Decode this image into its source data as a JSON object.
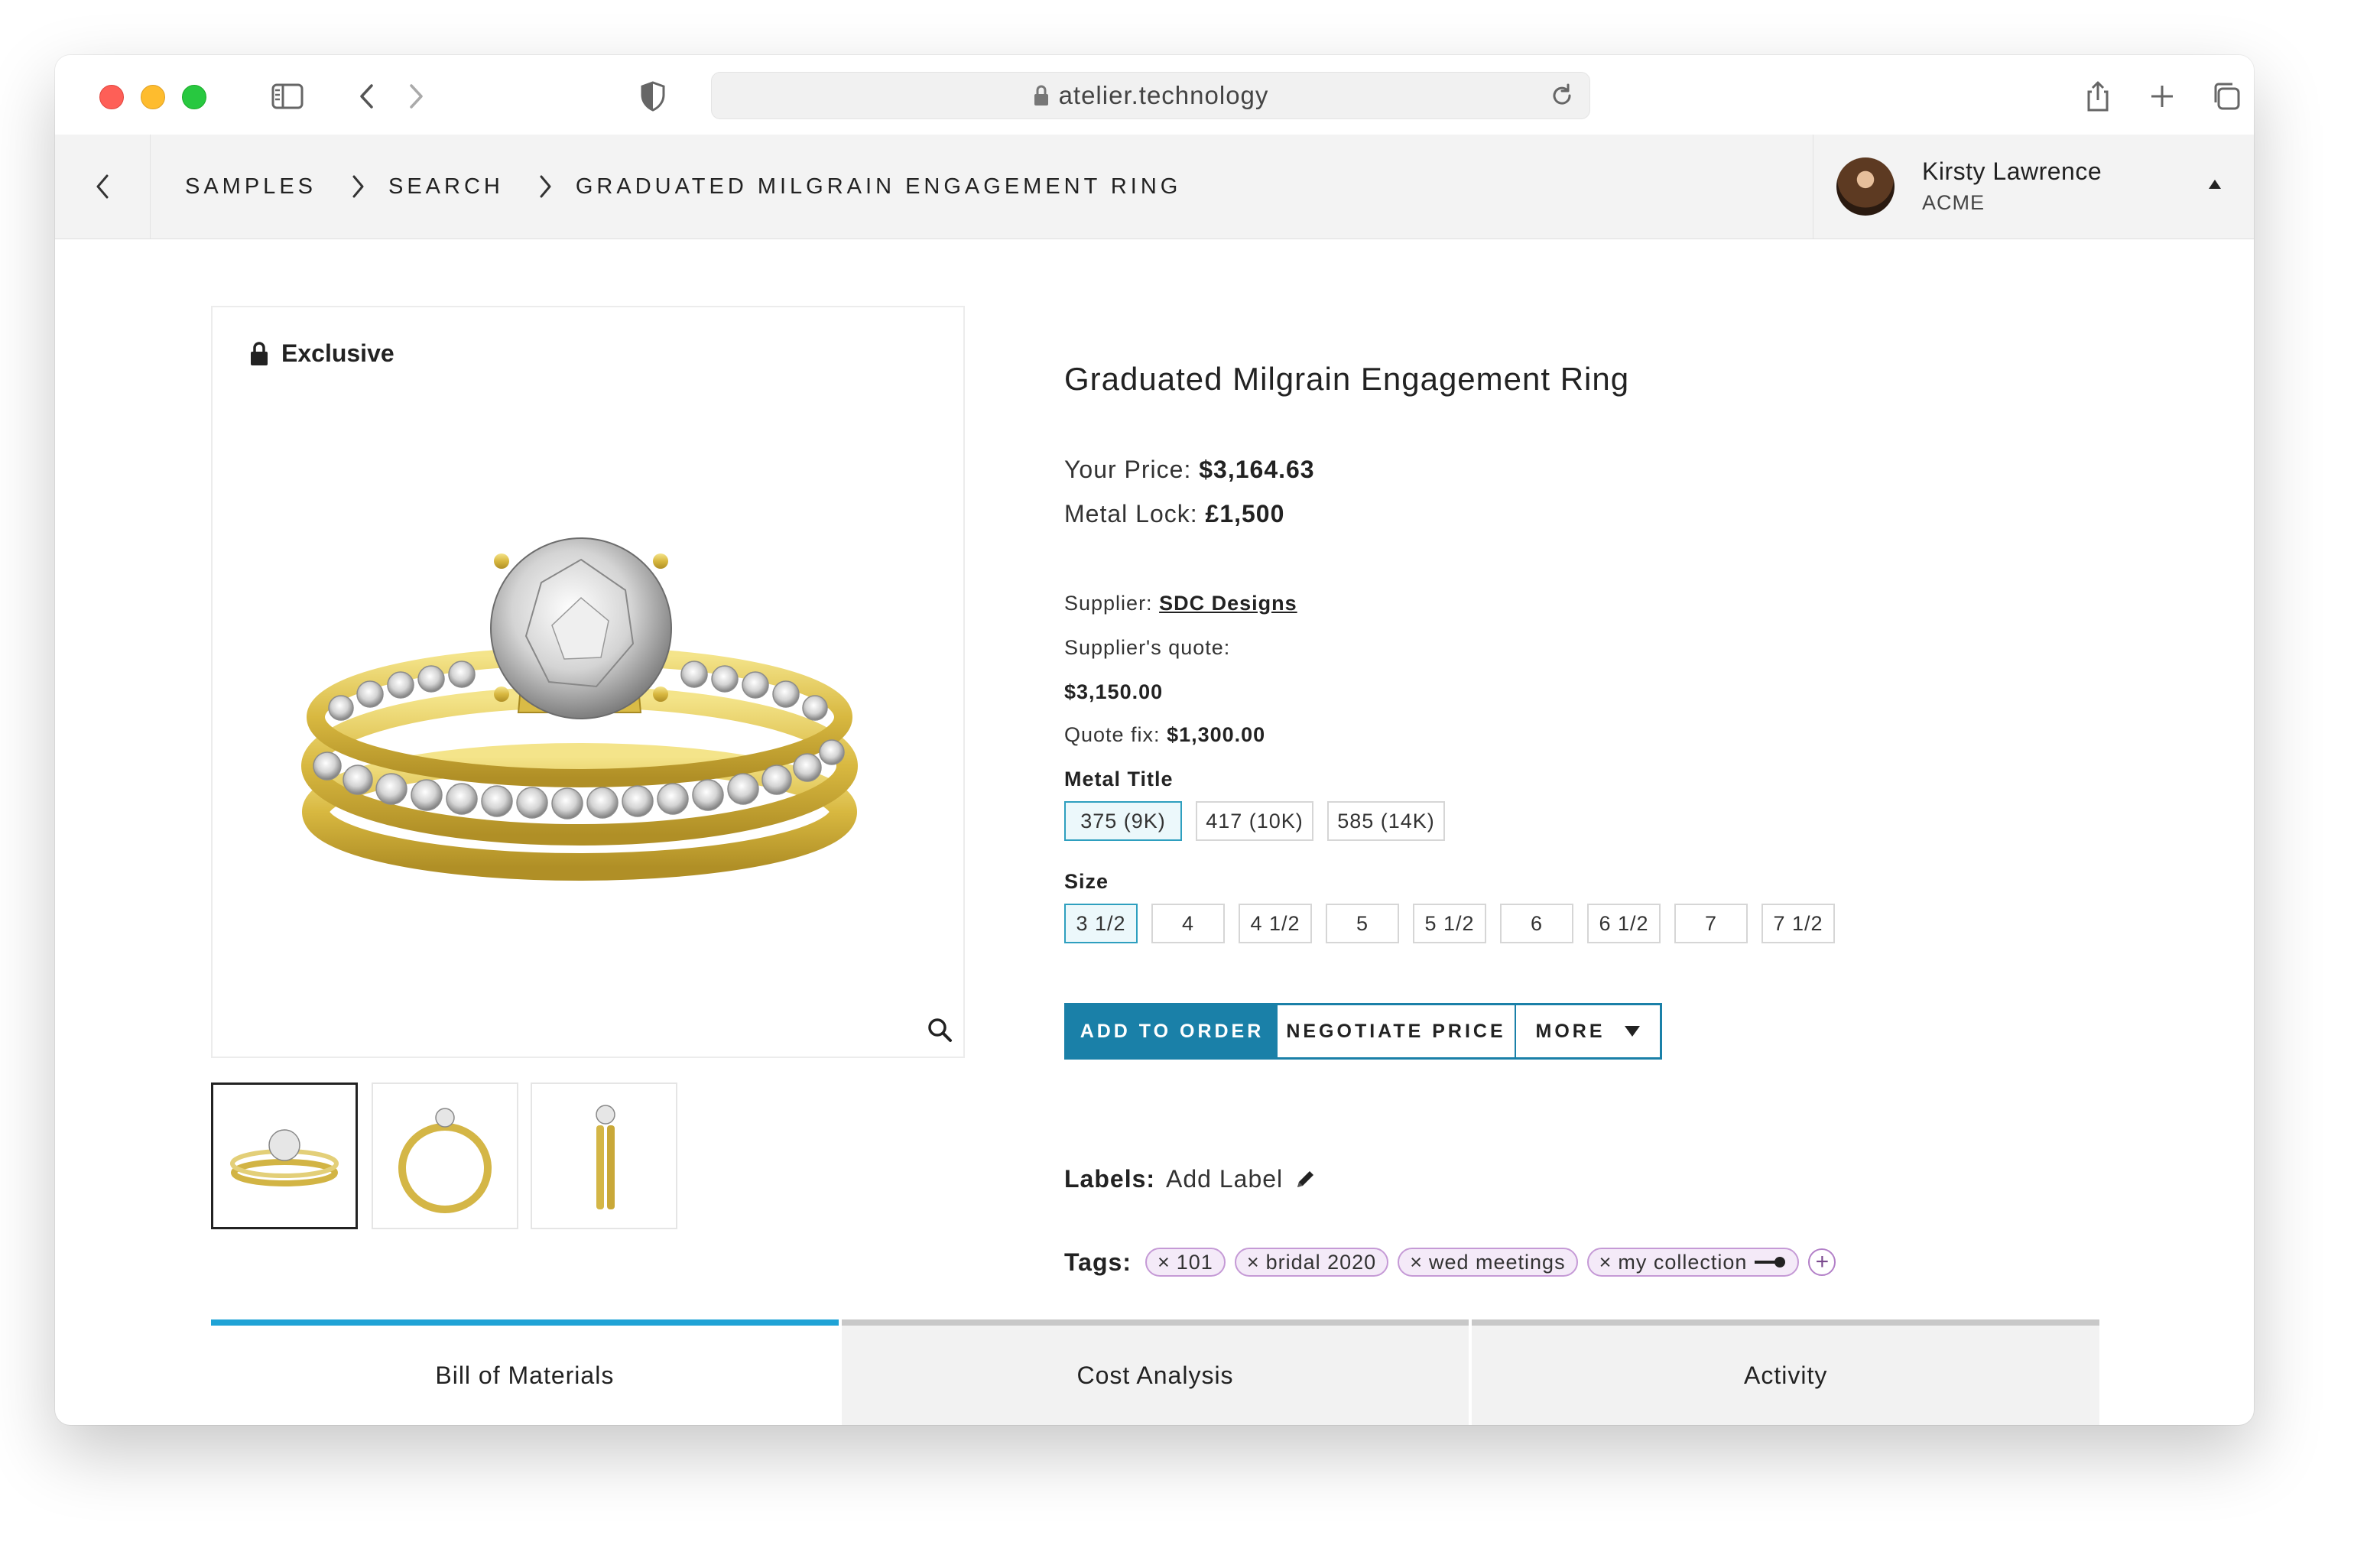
{
  "browser": {
    "url": "atelier.technology",
    "icons": {
      "sidebar": "sidebar-icon",
      "back": "chevron-left-icon",
      "forward": "chevron-right-icon",
      "privacy": "shield-icon",
      "lock": "lock-icon",
      "reload": "reload-icon",
      "share": "share-icon",
      "new_tab": "plus-icon",
      "tabs": "tabs-overview-icon"
    }
  },
  "header": {
    "breadcrumbs": [
      "SAMPLES",
      "SEARCH",
      "GRADUATED MILGRAIN ENGAGEMENT RING"
    ],
    "user": {
      "name": "Kirsty Lawrence",
      "org": "ACME"
    }
  },
  "product": {
    "badge": "Exclusive",
    "title": "Graduated Milgrain Engagement Ring",
    "your_price_label": "Your Price:",
    "your_price": "$3,164.63",
    "metal_lock_label": "Metal Lock:",
    "metal_lock": "£1,500",
    "supplier_label": "Supplier:",
    "supplier": "SDC Designs",
    "supplier_quote_label": "Supplier's quote:",
    "supplier_quote": "$3,150.00",
    "quote_fix_label": "Quote fix:",
    "quote_fix": "$1,300.00"
  },
  "metal_title": {
    "label": "Metal Title",
    "options": [
      "375 (9K)",
      "417 (10K)",
      "585 (14K)"
    ],
    "selected": "375 (9K)"
  },
  "size": {
    "label": "Size",
    "options": [
      "3 1/2",
      "4",
      "4 1/2",
      "5",
      "5 1/2",
      "6",
      "6 1/2",
      "7",
      "7 1/2"
    ],
    "selected": "3 1/2"
  },
  "actions": {
    "add_to_order": "ADD TO ORDER",
    "negotiate_price": "NEGOTIATE PRICE",
    "more": "MORE"
  },
  "labels": {
    "label": "Labels:",
    "add": "Add Label"
  },
  "tags": {
    "label": "Tags:",
    "items": [
      "101",
      "bridal 2020",
      "wed meetings",
      "my collection"
    ]
  },
  "tabs": [
    "Bill of Materials",
    "Cost Analysis",
    "Activity"
  ],
  "colors": {
    "accent": "#1a80a8",
    "tab_active": "#1fa3d6",
    "selected_option_border": "#2e9fbf",
    "tag_border": "#c59ad6",
    "tag_fill": "#f4eaf8"
  }
}
